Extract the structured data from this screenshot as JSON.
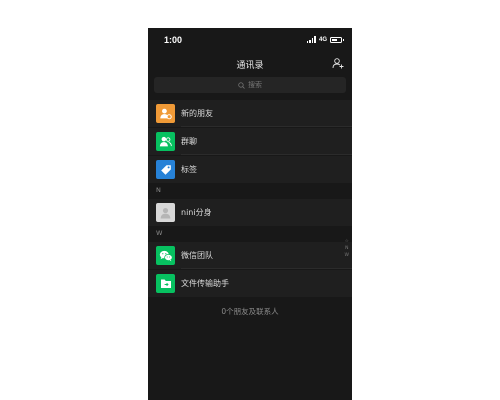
{
  "status_bar": {
    "time": "1:00",
    "network": "4G",
    "battery_level": 0.6
  },
  "header": {
    "title": "通讯录"
  },
  "search": {
    "placeholder": "搜索"
  },
  "top_items": [
    {
      "label": "新的朋友",
      "icon": "new-friend-icon",
      "color": "#f09a37"
    },
    {
      "label": "群聊",
      "icon": "group-chat-icon",
      "color": "#07c160"
    },
    {
      "label": "标签",
      "icon": "tag-icon",
      "color": "#2782d7"
    }
  ],
  "sections": [
    {
      "letter": "N",
      "contacts": [
        {
          "label": "nini分身",
          "icon": "default-avatar-icon",
          "color": "#d8d8d8"
        }
      ]
    },
    {
      "letter": "W",
      "contacts": [
        {
          "label": "微信团队",
          "icon": "wechat-logo-icon",
          "color": "#07c160"
        },
        {
          "label": "文件传输助手",
          "icon": "file-transfer-icon",
          "color": "#07c160"
        }
      ]
    }
  ],
  "footer": "0个朋友及联系人",
  "index_letters": [
    "☆",
    "N",
    "W"
  ],
  "colors": {
    "background": "#181818",
    "cell": "#1f1f1f",
    "accent": "#07c160"
  }
}
